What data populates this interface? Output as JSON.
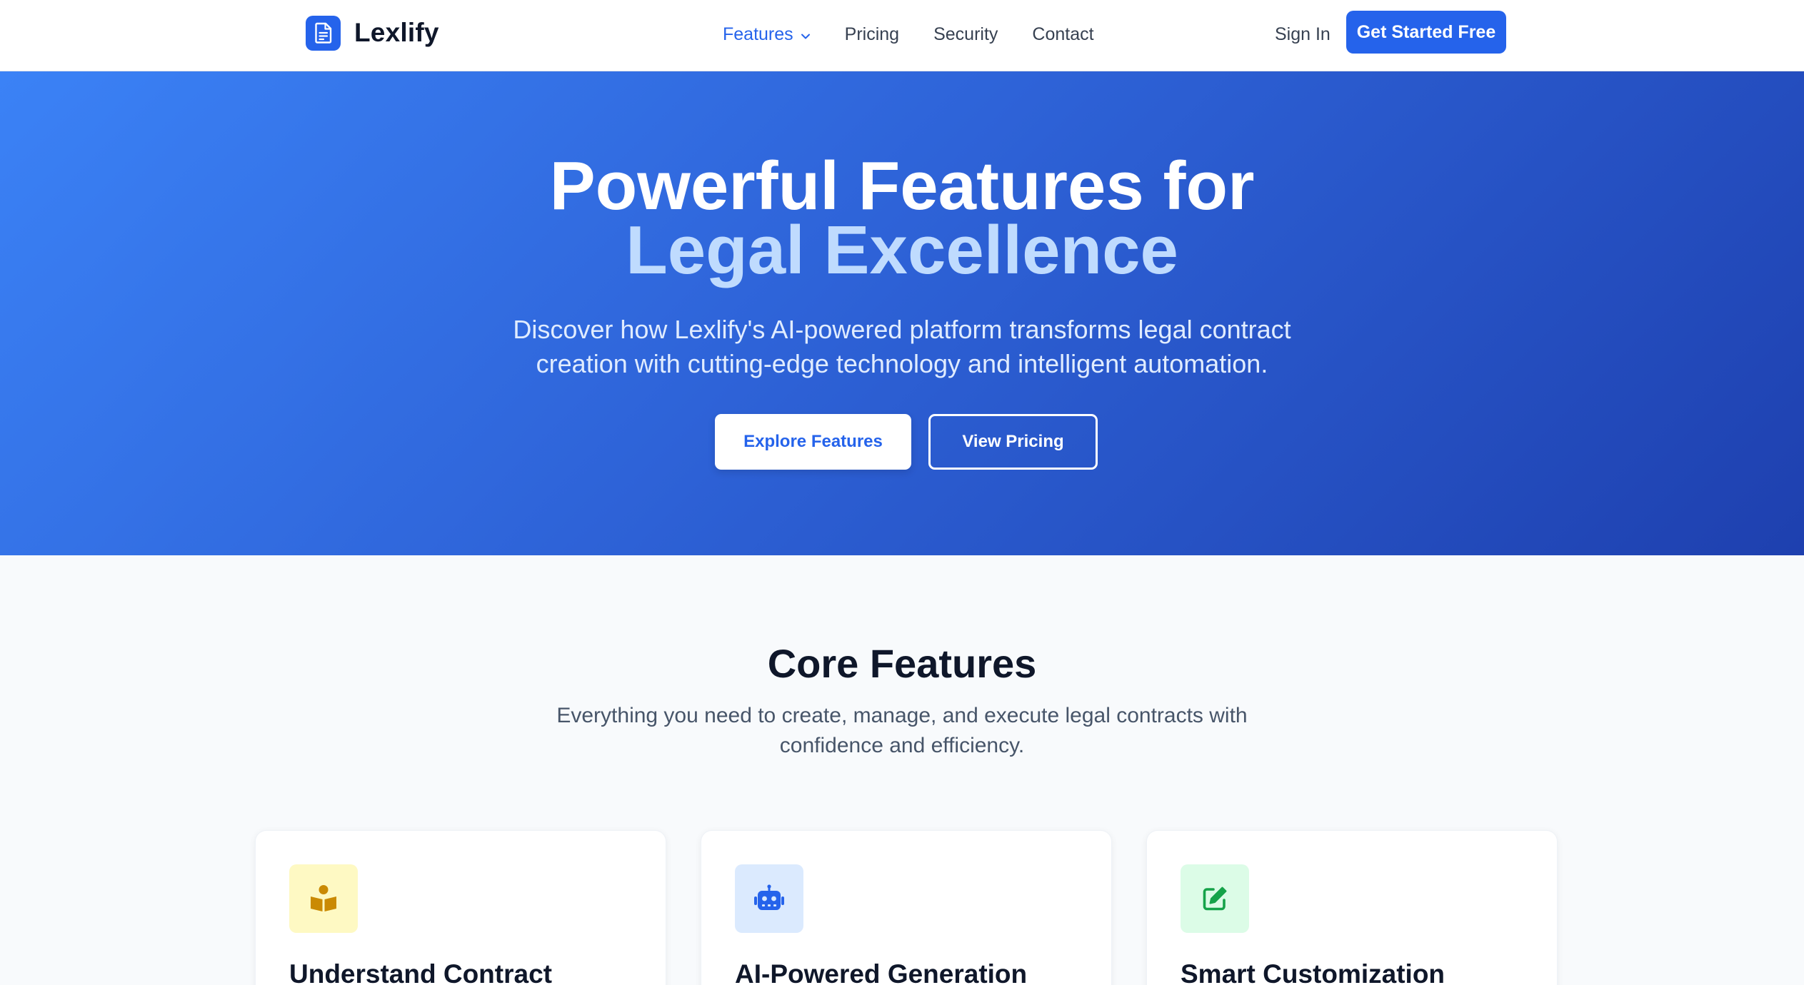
{
  "brand": {
    "name": "Lexlify",
    "icon": "document-icon",
    "accent": "#2563eb"
  },
  "nav": {
    "links": [
      {
        "label": "Features",
        "active": true,
        "has_dropdown": true
      },
      {
        "label": "Pricing",
        "active": false
      },
      {
        "label": "Security",
        "active": false
      },
      {
        "label": "Contact",
        "active": false
      }
    ],
    "sign_in": "Sign In",
    "cta": "Get Started Free"
  },
  "hero": {
    "title_line1": "Powerful Features for",
    "title_line2": "Legal Excellence",
    "subtitle": "Discover how Lexlify's AI-powered platform transforms legal contract creation with cutting-edge technology and intelligent automation.",
    "primary_button": "Explore Features",
    "secondary_button": "View Pricing",
    "gradient": [
      "#3b82f6",
      "#1e40af"
    ]
  },
  "core": {
    "title": "Core Features",
    "subtitle": "Everything you need to create, manage, and execute legal contracts with confidence and efficiency.",
    "cards": [
      {
        "title": "Understand Contract",
        "icon": "book-reader-icon",
        "icon_color": "#ca8a04",
        "icon_bg": "#fef9c3"
      },
      {
        "title": "AI-Powered Generation",
        "icon": "robot-icon",
        "icon_color": "#2563eb",
        "icon_bg": "#dbeafe"
      },
      {
        "title": "Smart Customization",
        "icon": "edit-icon",
        "icon_color": "#16a34a",
        "icon_bg": "#dcfce7"
      }
    ]
  }
}
